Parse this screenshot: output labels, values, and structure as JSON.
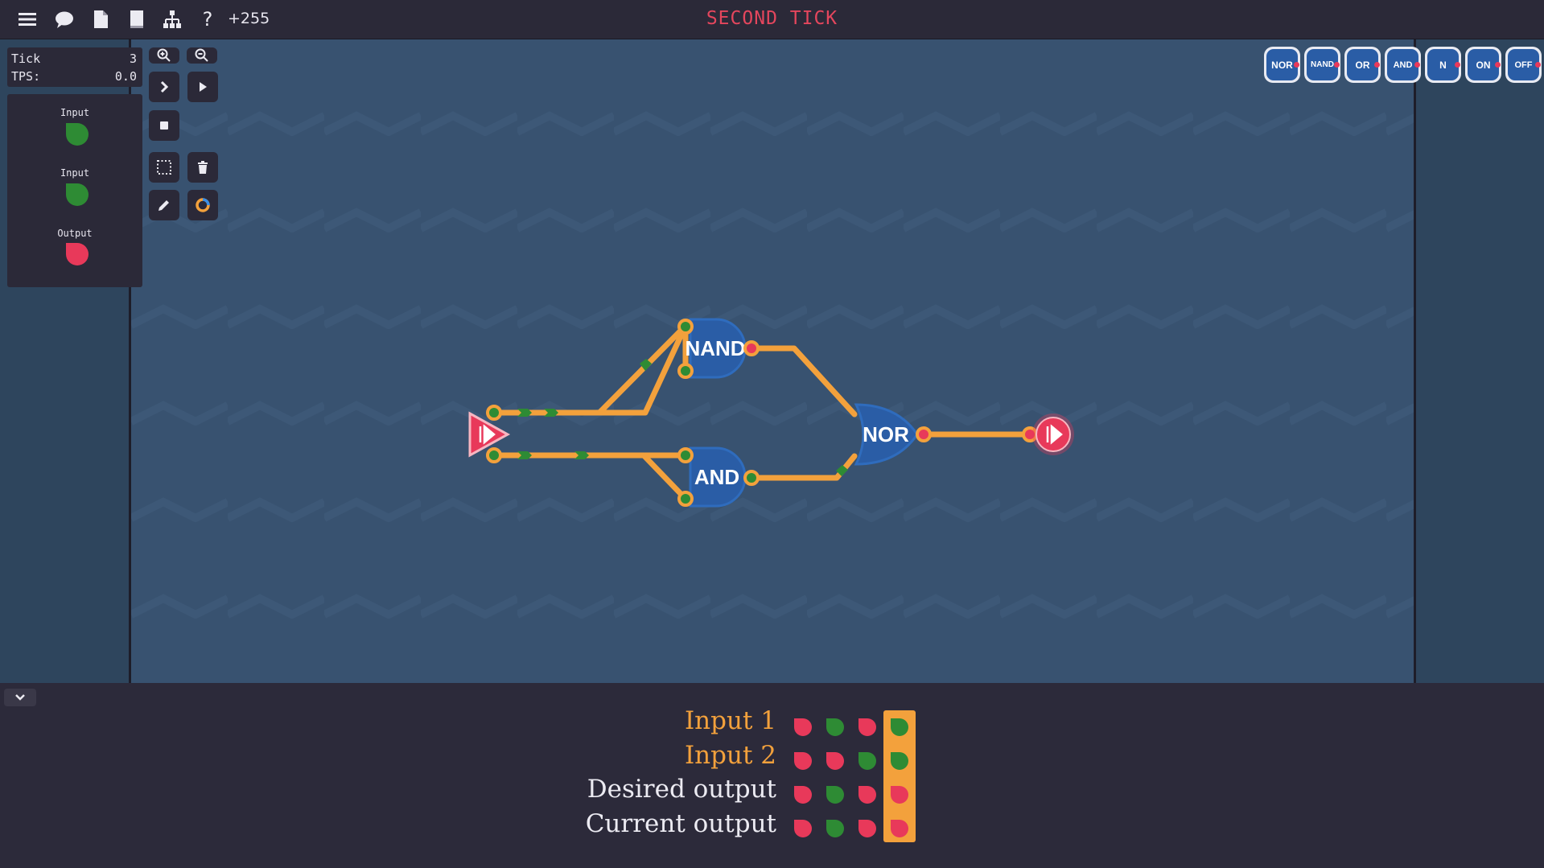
{
  "topbar": {
    "icons": [
      "menu-icon",
      "chat-icon",
      "document-icon",
      "book-icon",
      "hierarchy-icon",
      "help-icon"
    ],
    "help_glyph": "?",
    "score": "+255",
    "level_title": "SECOND TICK"
  },
  "sim": {
    "tick_label": "Tick",
    "tick_value": "3",
    "tps_label": "TPS:",
    "tps_value": "0.0"
  },
  "io_panel": [
    {
      "label": "Input",
      "state": "on"
    },
    {
      "label": "Input",
      "state": "on"
    },
    {
      "label": "Output",
      "state": "off"
    }
  ],
  "palette": [
    "NOR",
    "NAND",
    "OR",
    "AND",
    "N",
    "ON",
    "OFF"
  ],
  "circuit": {
    "gates": [
      "NAND",
      "AND",
      "NOR"
    ]
  },
  "truth_table": {
    "rows": [
      {
        "label": "Input 1",
        "color": "orange",
        "values": [
          "off",
          "on",
          "off",
          "on"
        ]
      },
      {
        "label": "Input 2",
        "color": "orange",
        "values": [
          "off",
          "off",
          "on",
          "on"
        ]
      },
      {
        "label": "Desired output",
        "color": "white",
        "values": [
          "off",
          "on",
          "off",
          "off"
        ]
      },
      {
        "label": "Current output",
        "color": "white",
        "values": [
          "off",
          "on",
          "off",
          "off"
        ]
      }
    ],
    "current_column": 4
  },
  "colors": {
    "wire": "#f3a13c",
    "on": "#2e8b34",
    "off": "#e8395a",
    "gate": "#2a5da6",
    "title": "#e4465d"
  }
}
